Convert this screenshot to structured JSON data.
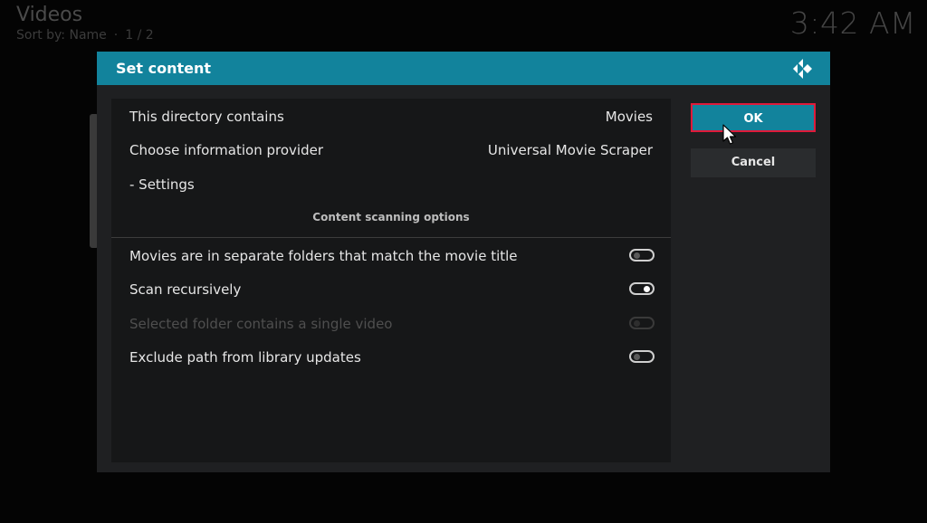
{
  "background": {
    "title": "Videos",
    "sort_label": "Sort by: Name",
    "separator": "·",
    "page": "1 / 2",
    "clock": "3:42 AM"
  },
  "dialog": {
    "title": "Set content",
    "logo_icon": "kodi-logo-icon",
    "rows": [
      {
        "label": "This directory contains",
        "value": "Movies"
      },
      {
        "label": "Choose information provider",
        "value": "Universal Movie Scraper"
      },
      {
        "label": "- Settings",
        "value": ""
      }
    ],
    "section_title": "Content scanning options",
    "options": [
      {
        "label": "Movies are in separate folders that match the movie title",
        "state": "off",
        "enabled": true
      },
      {
        "label": "Scan recursively",
        "state": "on",
        "enabled": true
      },
      {
        "label": "Selected folder contains a single video",
        "state": "off",
        "enabled": false
      },
      {
        "label": "Exclude path from library updates",
        "state": "off",
        "enabled": true
      }
    ],
    "buttons": {
      "ok": "OK",
      "cancel": "Cancel"
    }
  },
  "colors": {
    "accent": "#12839c",
    "focus_border": "#e01a3a"
  }
}
